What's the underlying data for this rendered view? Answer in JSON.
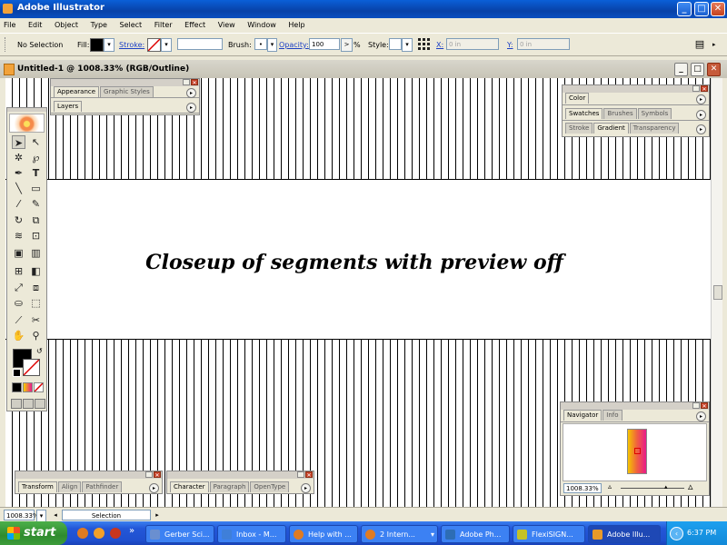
{
  "app": {
    "title": "Adobe Illustrator",
    "title_buttons": [
      "_",
      "□",
      "✕"
    ]
  },
  "menu": [
    "File",
    "Edit",
    "Object",
    "Type",
    "Select",
    "Filter",
    "Effect",
    "View",
    "Window",
    "Help"
  ],
  "control_bar": {
    "selection_label": "No Selection",
    "fill_label": "Fill:",
    "stroke_label": "Stroke:",
    "brush_label": "Brush:",
    "opacity_label": "Opacity:",
    "opacity_value": "100",
    "opacity_unit": "%",
    "style_label": "Style:",
    "x_label": "X:",
    "x_value": "0 in",
    "y_label": "Y:",
    "y_value": "0 in",
    "fill_color": "#000000"
  },
  "document": {
    "title": "Untitled-1 @ 1008.33% (RGB/Outline)",
    "canvas_text": "Closeup of segments with preview off",
    "zoom": "1008.33%",
    "status": "Selection"
  },
  "palettes": {
    "appearance": [
      "Appearance",
      "Graphic Styles"
    ],
    "layers": [
      "Layers"
    ],
    "color": [
      "Color"
    ],
    "swatches": [
      "Swatches",
      "Brushes",
      "Symbols"
    ],
    "stroke": [
      "Stroke",
      "Gradient",
      "Transparency"
    ],
    "navigator": [
      "Navigator",
      "Info"
    ],
    "navigator_zoom": "1008.33%",
    "transform": [
      "Transform",
      "Align",
      "Pathfinder"
    ],
    "character": [
      "Character",
      "Paragraph",
      "OpenType"
    ]
  },
  "taskbar": {
    "start": "start",
    "clock": "6:37 PM",
    "overflow": "»",
    "buttons": [
      {
        "label": "Gerber Sci...",
        "color": "#6a8fd0"
      },
      {
        "label": "Inbox - M...",
        "color": "#3f7fd9"
      },
      {
        "label": "Help with ...",
        "color": "#e07b22"
      },
      {
        "label": "2 Intern...",
        "color": "#e07b22"
      },
      {
        "label": "Adobe Ph...",
        "color": "#2d6db5"
      },
      {
        "label": "FlexiSIGN...",
        "color": "#c4c226"
      },
      {
        "label": "Adobe Illu...",
        "color": "#e89a2a"
      }
    ]
  }
}
